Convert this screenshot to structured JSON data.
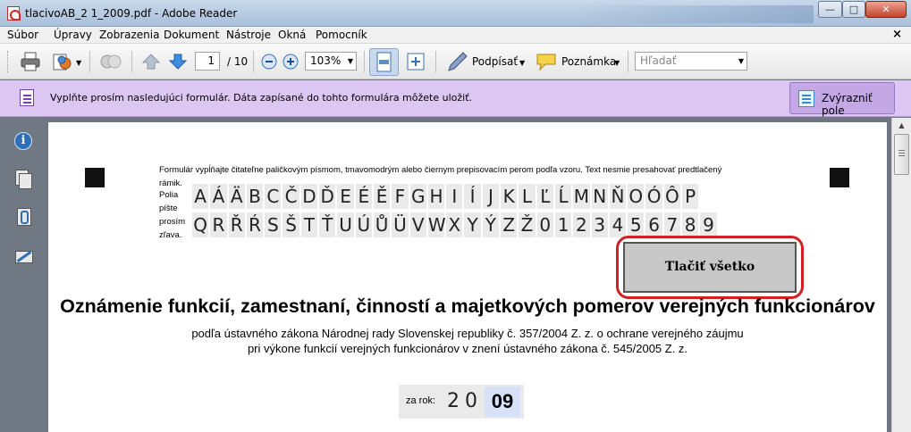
{
  "window": {
    "title": "tlacivoAB_2 1_2009.pdf - Adobe Reader",
    "minimize": "—",
    "maximize": "□",
    "close": "✕"
  },
  "menu": {
    "items": [
      "Súbor",
      "Úpravy",
      "Zobrazenia",
      "Dokument",
      "Nástroje",
      "Okná",
      "Pomocník"
    ],
    "close": "×"
  },
  "toolbar": {
    "page_current": "1",
    "page_total": "/ 10",
    "zoom": "103%",
    "sign_label": "Podpísať",
    "comment_label": "Poznámka",
    "search_placeholder": "Hľadať",
    "dropdown_arrow": "▼",
    "icons": [
      "printer-icon",
      "share-icon",
      "attach-icon",
      "arrow-up-icon",
      "arrow-down-icon",
      "zoom-out-icon",
      "zoom-in-icon",
      "fit-page-icon",
      "fit-width-icon",
      "pen-icon",
      "comment-icon"
    ]
  },
  "banner": {
    "text": "Vyplňte prosím nasledujúci formulár. Dáta zapísané do tohto formulára môžete uložiť.",
    "highlight_button": "Zvýrazniť pole",
    "color": "#dcc6f2"
  },
  "document": {
    "instructions": "Formulár vypĺňajte čitateľne paličkovým  písmom, tmavomodrým alebo čiernym prepisovacím perom podľa vzoru. Text nesmie presahovať predtlačený",
    "side_labels": [
      "rámik.",
      "Polia",
      "píšte",
      "prosím",
      "zľava."
    ],
    "char_row_1": [
      "A",
      "Á",
      "Ä",
      "B",
      "C",
      "Č",
      "D",
      "Ď",
      "E",
      "É",
      "Ě",
      "F",
      "G",
      "H",
      "I",
      "Í",
      "J",
      "K",
      "L",
      "Ľ",
      "Ĺ",
      "M",
      "N",
      "Ň",
      "O",
      "Ó",
      "Ô",
      "P"
    ],
    "char_row_2": [
      "Q",
      "R",
      "Ř",
      "Ŕ",
      "S",
      "Š",
      "T",
      "Ť",
      "U",
      "Ú",
      "Ů",
      "Ü",
      "V",
      "W",
      "X",
      "Y",
      "Ý",
      "Z",
      "Ž",
      "0",
      "1",
      "2",
      "3",
      "4",
      "5",
      "6",
      "7",
      "8",
      "9"
    ],
    "print_all_button": "Tlačiť všetko",
    "title": "Oznámenie funkcií, zamestnaní, činností a majetkových pomerov verejných funkcionárov",
    "subtitle_1": "podľa ústavného zákona Národnej rady Slovenskej republiky č. 357/2004 Z. z. o ochrane verejného záujmu",
    "subtitle_2": "pri výkone funkcií verejných funkcionárov v znení ústavného zákona č. 545/2005 Z. z.",
    "year_label": "za rok:",
    "year_prefix_1": "2",
    "year_prefix_2": "0",
    "year_value": "09",
    "highlight_color": "#d42020"
  },
  "left_nav": {
    "info_glyph": "i",
    "icons": [
      "info-icon",
      "pages-icon",
      "attachments-icon",
      "signatures-icon"
    ]
  }
}
